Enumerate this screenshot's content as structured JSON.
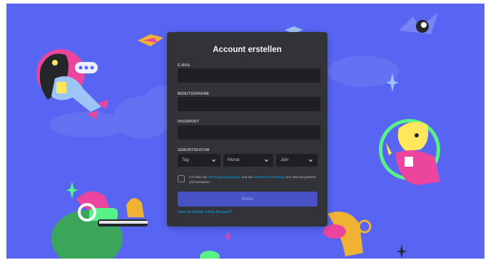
{
  "form": {
    "title": "Account erstellen",
    "email_label": "E-MAIL",
    "email_value": "",
    "username_label": "BENUTZERNAME",
    "username_value": "",
    "password_label": "PASSWORT",
    "password_value": "",
    "birthdate_label": "GEBURTSDATUM",
    "day_placeholder": "Tag",
    "month_placeholder": "Monat",
    "year_placeholder": "Jahr",
    "terms_prefix": "Ich habe die ",
    "terms_link": "Nutzungsbedingungen",
    "terms_middle": " und die ",
    "privacy_link": "Datenschutzerklärung",
    "terms_suffix": " von Discord gelesen und akzeptiert.",
    "submit_label": "Weiter",
    "login_link": "Hast du bereits einen Account?"
  },
  "colors": {
    "background": "#5865f2",
    "modal": "#313338",
    "input": "#1e1f22",
    "button": "#4752c4",
    "link": "#00a8fc"
  }
}
